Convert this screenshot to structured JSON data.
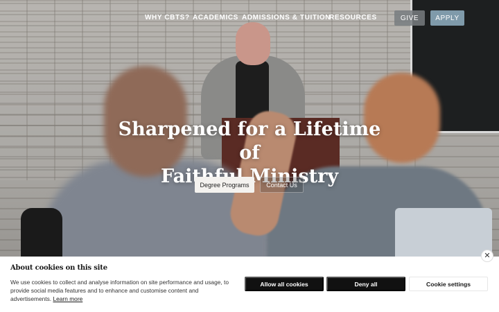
{
  "nav": {
    "links": [
      "WHY CBTS?",
      "ACADEMICS",
      "ADMISSIONS & TUITION",
      "RESOURCES"
    ],
    "give_label": "GIVE",
    "apply_label": "APPLY"
  },
  "hero": {
    "headline_line1": "Sharpened for a Lifetime of",
    "headline_line2": "Faithful Ministry",
    "primary_cta": "Degree Programs",
    "secondary_cta": "Contact Us"
  },
  "cookie_banner": {
    "title": "About cookies on this site",
    "body": "We use cookies to collect and analyse information on site performance and usage, to provide social media features and to enhance and customise content and advertisements.",
    "learn_more": "Learn more",
    "allow_all": "Allow all cookies",
    "deny_all": "Deny all",
    "settings": "Cookie settings",
    "close_icon": "close-icon"
  },
  "colors": {
    "apply_button": "#7f9aaa",
    "cookie_button": "#111111",
    "banner_bg": "#ffffff"
  }
}
